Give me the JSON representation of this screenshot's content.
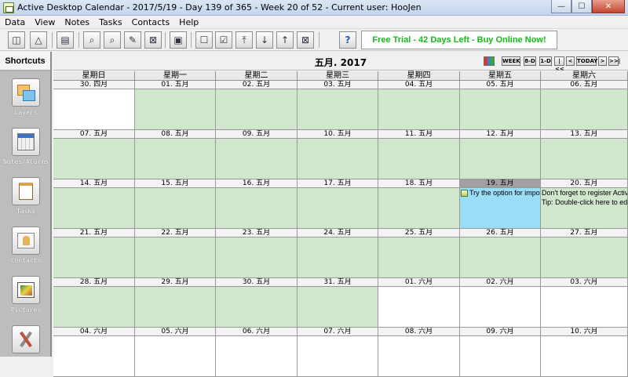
{
  "window": {
    "title": "Active Desktop Calendar - 2017/5/19 - Day 139 of 365 - Week 20 of 52 - Current user: HooJen",
    "minimize": "—",
    "maximize": "☐",
    "close": "✕"
  },
  "menu": [
    "Data",
    "View",
    "Notes",
    "Tasks",
    "Contacts",
    "Help"
  ],
  "toolbar": {
    "trial_banner": "Free Trial - 42 Days Left - Buy Online Now!",
    "help_glyph": "?"
  },
  "sidebar": {
    "title": "Shortcuts",
    "items": [
      {
        "label": "Layers",
        "icon": "layers-icon"
      },
      {
        "label": "Notes/Alarms",
        "icon": "notes-alarms-icon"
      },
      {
        "label": "Tasks",
        "icon": "tasks-icon"
      },
      {
        "label": "Contacts",
        "icon": "contacts-icon"
      },
      {
        "label": "Pictures",
        "icon": "pictures-icon"
      },
      {
        "label": "",
        "icon": "tools-icon"
      }
    ]
  },
  "calendar": {
    "title": "五月. 2017",
    "nav": {
      "week": "WEEK",
      "eight_d": "8-D",
      "one_d": "1-D",
      "prev_fast": "|<<",
      "prev": "<",
      "today": "TODAY",
      "next": ">",
      "next_fast": ">>|"
    },
    "weekdays": [
      "星期日",
      "星期一",
      "星期二",
      "星期三",
      "星期四",
      "星期五",
      "星期六"
    ],
    "weeks": [
      [
        {
          "label": "30. 四月",
          "other": true
        },
        {
          "label": "01. 五月"
        },
        {
          "label": "02. 五月"
        },
        {
          "label": "03. 五月"
        },
        {
          "label": "04. 五月"
        },
        {
          "label": "05. 五月"
        },
        {
          "label": "06. 五月"
        }
      ],
      [
        {
          "label": "07. 五月"
        },
        {
          "label": "08. 五月"
        },
        {
          "label": "09. 五月"
        },
        {
          "label": "10. 五月"
        },
        {
          "label": "11. 五月"
        },
        {
          "label": "12. 五月"
        },
        {
          "label": "13. 五月"
        }
      ],
      [
        {
          "label": "14. 五月"
        },
        {
          "label": "15. 五月"
        },
        {
          "label": "16. 五月"
        },
        {
          "label": "17. 五月"
        },
        {
          "label": "18. 五月"
        },
        {
          "label": "19. 五月",
          "today": true,
          "events": [
            {
              "text": "Try the option for importing",
              "icon": true
            }
          ]
        },
        {
          "label": "20. 五月",
          "events": [
            {
              "text": "Don't forget to register Active D"
            },
            {
              "text": "Tip: Double-click here to edit th"
            }
          ]
        }
      ],
      [
        {
          "label": "21. 五月"
        },
        {
          "label": "22. 五月"
        },
        {
          "label": "23. 五月"
        },
        {
          "label": "24. 五月"
        },
        {
          "label": "25. 五月"
        },
        {
          "label": "26. 五月"
        },
        {
          "label": "27. 五月"
        }
      ],
      [
        {
          "label": "28. 五月"
        },
        {
          "label": "29. 五月"
        },
        {
          "label": "30. 五月"
        },
        {
          "label": "31. 五月"
        },
        {
          "label": "01. 六月",
          "other": true
        },
        {
          "label": "02. 六月",
          "other": true
        },
        {
          "label": "03. 六月",
          "other": true
        }
      ],
      [
        {
          "label": "04. 六月",
          "other": true
        },
        {
          "label": "05. 六月",
          "other": true
        },
        {
          "label": "06. 六月",
          "other": true
        },
        {
          "label": "07. 六月",
          "other": true
        },
        {
          "label": "08. 六月",
          "other": true
        },
        {
          "label": "09. 六月",
          "other": true
        },
        {
          "label": "10. 六月",
          "other": true
        }
      ]
    ]
  }
}
